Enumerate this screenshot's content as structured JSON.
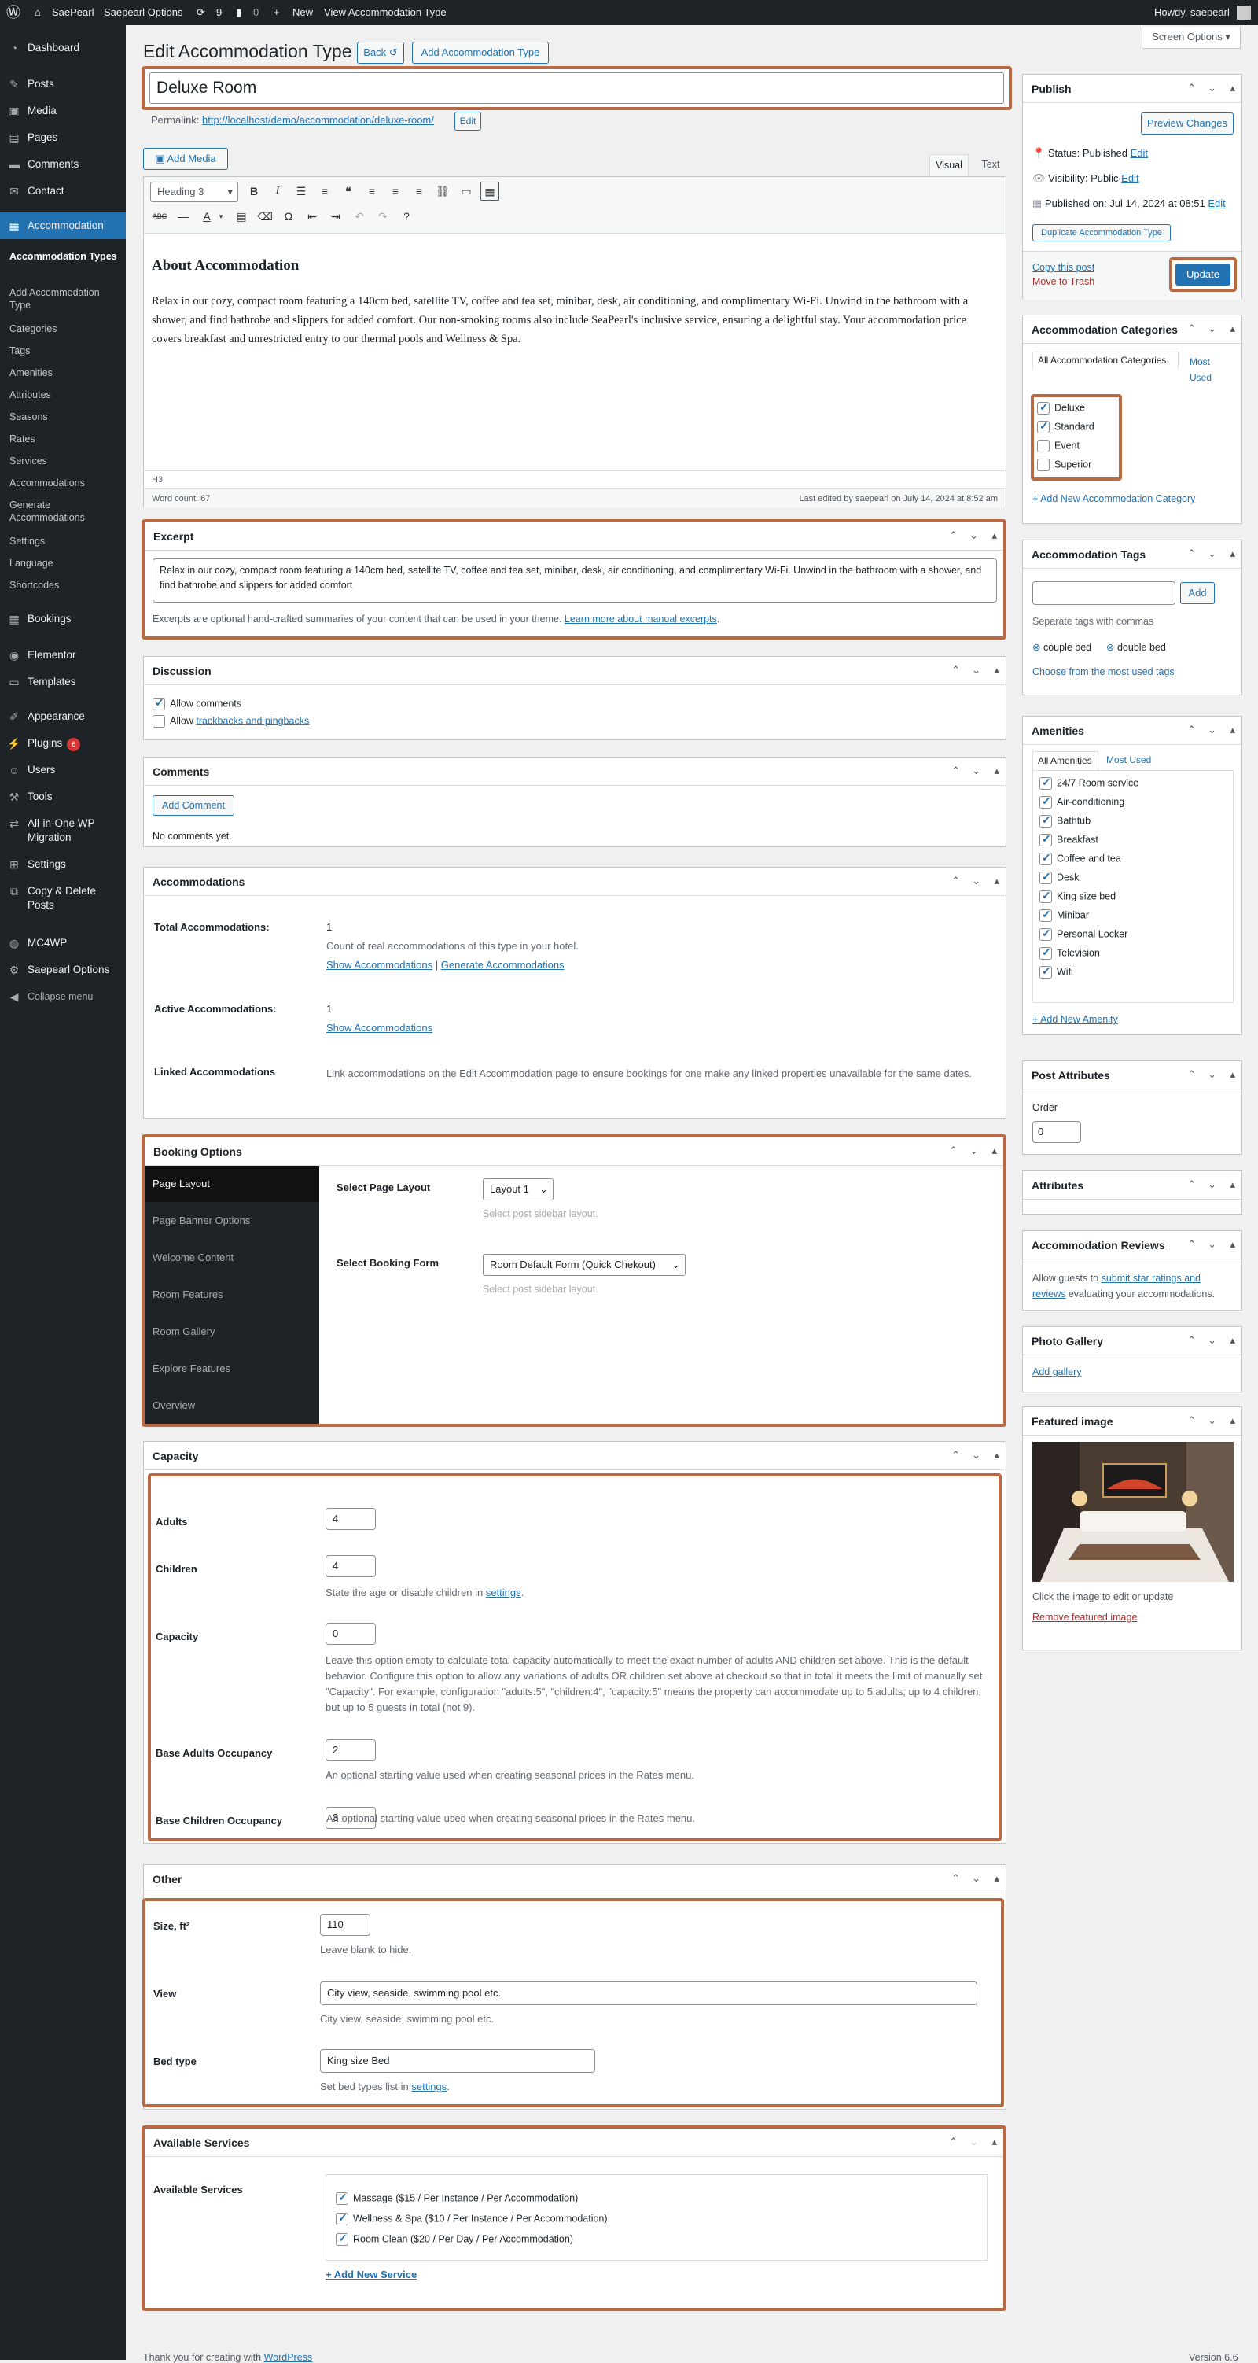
{
  "adminbar": {
    "site": "SaePearl",
    "options": "Saepearl Options",
    "updates": "9",
    "comments": "0",
    "new": "New",
    "view": "View Accommodation Type",
    "howdy": "Howdy, saepearl"
  },
  "menu": {
    "dashboard": "Dashboard",
    "posts": "Posts",
    "media": "Media",
    "pages": "Pages",
    "comments": "Comments",
    "contact": "Contact",
    "accommodation": "Accommodation",
    "sub": [
      "Accommodation Types",
      "Add Accommodation Type",
      "Categories",
      "Tags",
      "Amenities",
      "Attributes",
      "Seasons",
      "Rates",
      "Services",
      "Accommodations",
      "Generate Accommodations",
      "Settings",
      "Language",
      "Shortcodes"
    ],
    "bookings": "Bookings",
    "elementor": "Elementor",
    "templates": "Templates",
    "appearance": "Appearance",
    "plugins": "Plugins",
    "plugins_badge": "6",
    "users": "Users",
    "tools": "Tools",
    "allinone": "All-in-One WP Migration",
    "settings": "Settings",
    "copydelete": "Copy & Delete Posts",
    "mc4wp": "MC4WP",
    "saepearl": "Saepearl Options",
    "collapse": "Collapse menu"
  },
  "header": {
    "title": "Edit Accommodation Type",
    "back": "Back",
    "add": "Add Accommodation Type",
    "screen_options": "Screen Options"
  },
  "post": {
    "title": "Deluxe Room",
    "permalink_label": "Permalink:",
    "permalink": "http://localhost/demo/accommodation/deluxe-room/",
    "edit": "Edit"
  },
  "editor": {
    "add_media": "Add Media",
    "tab_visual": "Visual",
    "tab_text": "Text",
    "format": "Heading 3",
    "heading": "About Accommodation",
    "body": "Relax in our cozy, compact room featuring a 140cm bed, satellite TV, coffee and tea set, minibar, desk, air conditioning, and complimentary Wi-Fi. Unwind in the bathroom with a shower, and find bathrobe and slippers for added comfort. Our non-smoking rooms also include SeaPearl's inclusive service, ensuring a delightful stay. Your accommodation price covers breakfast and unrestricted entry to our thermal pools and Wellness & Spa.",
    "path": "H3",
    "wordcount": "Word count: 67",
    "lastedited": "Last edited by saepearl on July 14, 2024 at 8:52 am"
  },
  "excerpt": {
    "title": "Excerpt",
    "text": "Relax in our cozy, compact room featuring a 140cm bed, satellite TV, coffee and tea set, minibar, desk, air conditioning, and complimentary Wi-Fi. Unwind in the bathroom with a shower, and find bathrobe and slippers for added comfort",
    "help": "Excerpts are optional hand-crafted summaries of your content that can be used in your theme.",
    "help_link": "Learn more about manual excerpts",
    "period": "."
  },
  "discussion": {
    "title": "Discussion",
    "allow_comments": "Allow comments",
    "allow_prefix": "Allow",
    "trackbacks": "trackbacks and pingbacks"
  },
  "comments": {
    "title": "Comments",
    "add": "Add Comment",
    "none": "No comments yet."
  },
  "accommodations": {
    "title": "Accommodations",
    "total_label": "Total Accommodations:",
    "total": "1",
    "total_desc": "Count of real accommodations of this type in your hotel.",
    "show": "Show Accommodations",
    "sep": "|",
    "generate": "Generate Accommodations",
    "active_label": "Active Accommodations:",
    "active": "1",
    "linked_label": "Linked Accommodations",
    "linked_desc": "Link accommodations on the Edit Accommodation page to ensure bookings for one make any linked properties unavailable for the same dates."
  },
  "booking": {
    "title": "Booking Options",
    "tabs": [
      "Page Layout",
      "Page Banner Options",
      "Welcome Content",
      "Room Features",
      "Room Gallery",
      "Explore Features",
      "Overview"
    ],
    "layout_label": "Select Page Layout",
    "layout_value": "Layout 1",
    "layout_desc": "Select post sidebar layout.",
    "form_label": "Select Booking Form",
    "form_value": "Room Default Form (Quick Chekout)",
    "form_desc": "Select post sidebar layout."
  },
  "capacity": {
    "title": "Capacity",
    "adults_label": "Adults",
    "adults": "4",
    "children_label": "Children",
    "children": "4",
    "children_desc_pre": "State the age or disable children in",
    "settings_link": "settings",
    "capacity_label": "Capacity",
    "capacity": "0",
    "capacity_desc": "Leave this option empty to calculate total capacity automatically to meet the exact number of adults AND children set above. This is the default behavior. Configure this option to allow any variations of adults OR children set above at checkout so that in total it meets the limit of manually set \"Capacity\". For example, configuration \"adults:5\", \"children:4\", \"capacity:5\" means the property can accommodate up to 5 adults, up to 4 children, but up to 5 guests in total (not 9).",
    "base_adults_label": "Base Adults Occupancy",
    "base_adults": "2",
    "base_adults_desc": "An optional starting value used when creating seasonal prices in the Rates menu.",
    "base_children_label": "Base Children Occupancy",
    "base_children": "3",
    "base_children_desc": "An optional starting value used when creating seasonal prices in the Rates menu."
  },
  "other": {
    "title": "Other",
    "size_label": "Size, ft²",
    "size": "110",
    "size_desc": "Leave blank to hide.",
    "view_label": "View",
    "view": "City view, seaside, swimming pool etc.",
    "view_desc": "City view, seaside, swimming pool etc.",
    "bed_label": "Bed type",
    "bed": "King size Bed",
    "bed_desc_pre": "Set bed types list in",
    "settings_link": "settings"
  },
  "services": {
    "title": "Available Services",
    "label": "Available Services",
    "items": [
      "Massage ($15 / Per Instance / Per Accommodation)",
      "Wellness & Spa ($10 / Per Instance / Per Accommodation)",
      "Room Clean ($20 / Per Day / Per Accommodation)"
    ],
    "add": "+ Add New Service"
  },
  "publish": {
    "title": "Publish",
    "preview": "Preview Changes",
    "status_label": "Status:",
    "status": "Published",
    "visibility_label": "Visibility:",
    "visibility": "Public",
    "published_label": "Published on:",
    "published": "Jul 14, 2024 at 08:51",
    "edit": "Edit",
    "duplicate": "Duplicate Accommodation Type",
    "copy": "Copy this post",
    "trash": "Move to Trash",
    "update": "Update"
  },
  "categories": {
    "title": "Accommodation Categories",
    "tab_all": "All Accommodation Categories",
    "tab_most": "Most Used",
    "items": [
      {
        "label": "Deluxe",
        "checked": true
      },
      {
        "label": "Standard",
        "checked": true
      },
      {
        "label": "Event",
        "checked": false
      },
      {
        "label": "Superior",
        "checked": false
      }
    ],
    "add": "+ Add New Accommodation Category"
  },
  "tags": {
    "title": "Accommodation Tags",
    "add": "Add",
    "help": "Separate tags with commas",
    "items": [
      "couple bed",
      "double bed"
    ],
    "choose": "Choose from the most used tags"
  },
  "amenities": {
    "title": "Amenities",
    "tab_all": "All Amenities",
    "tab_most": "Most Used",
    "items": [
      "24/7 Room service",
      "Air-conditioning",
      "Bathtub",
      "Breakfast",
      "Coffee and tea",
      "Desk",
      "King size bed",
      "Minibar",
      "Personal Locker",
      "Television",
      "Wifi"
    ],
    "add": "+ Add New Amenity"
  },
  "attributes_box": {
    "title": "Post Attributes",
    "order_label": "Order",
    "order": "0"
  },
  "attributes": {
    "title": "Attributes"
  },
  "reviews": {
    "title": "Accommodation Reviews",
    "pre": "Allow guests to",
    "link": "submit star ratings and reviews",
    "post": "evaluating your accommodations."
  },
  "gallery": {
    "title": "Photo Gallery",
    "add": "Add gallery"
  },
  "featured": {
    "title": "Featured image",
    "help": "Click the image to edit or update",
    "remove": "Remove featured image"
  },
  "footer": {
    "thanks": "Thank you for creating with",
    "wp": "WordPress",
    "version": "Version 6.6"
  },
  "colors": {
    "accent": "#2271b1",
    "highlight": "#b86a45",
    "adminbar": "#1d2327"
  }
}
